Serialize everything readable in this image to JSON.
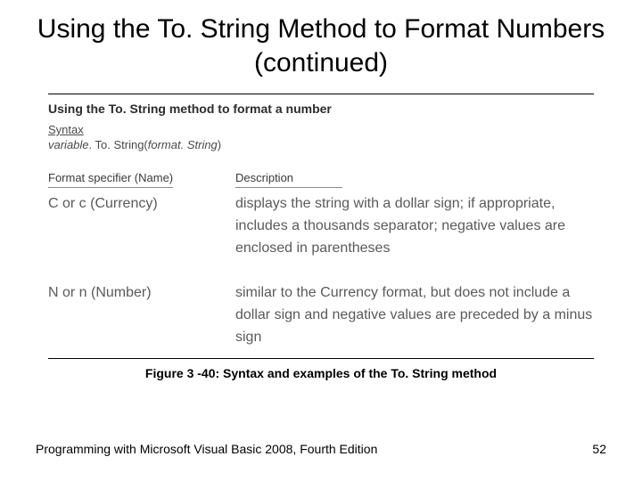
{
  "title": "Using the To. String Method to Format Numbers (continued)",
  "section_title": "Using the To. String method to format a number",
  "syntax_label": "Syntax",
  "syntax_var": "variable",
  "syntax_method": ". To. String(",
  "syntax_arg": "format. String",
  "syntax_close": ")",
  "col_headers": {
    "left": "Format specifier (Name)",
    "right": "Description"
  },
  "rows": [
    {
      "name": "C or c  (Currency)",
      "desc": "displays the string with a dollar sign; if appropriate, includes a thousands separator; negative values are enclosed in parentheses"
    },
    {
      "name": "N or n  (Number)",
      "desc": "similar to the Currency format, but does not include a dollar sign and negative values are preceded by a minus sign"
    }
  ],
  "caption": "Figure 3 -40: Syntax and examples of the To. String method",
  "footer_left": "Programming with Microsoft Visual Basic 2008, Fourth Edition",
  "footer_right": "52"
}
